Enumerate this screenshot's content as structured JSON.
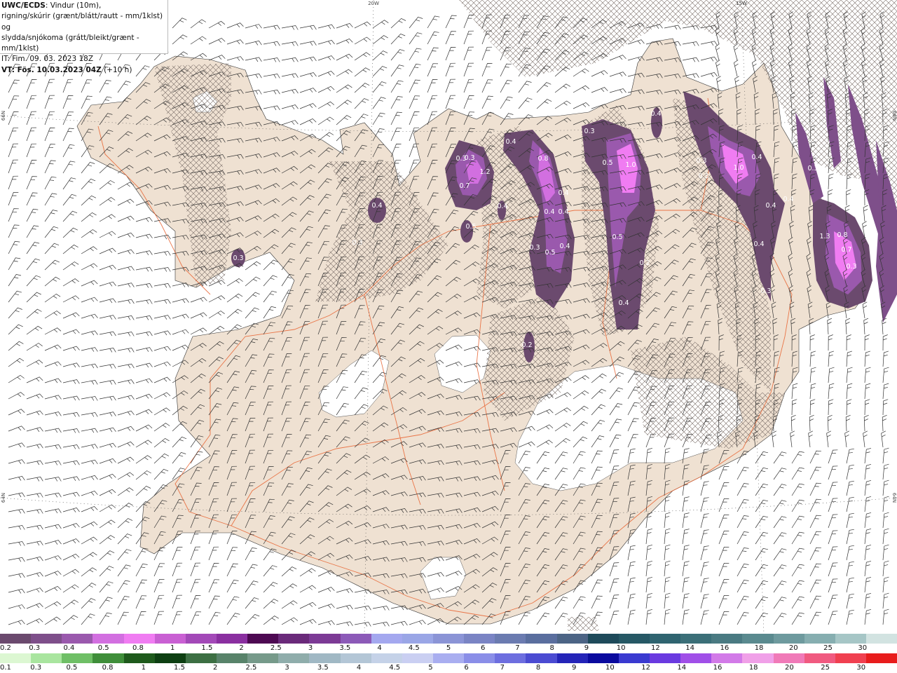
{
  "header": {
    "model": "UWC/ECDS",
    "description_line1": ": Vindur (10m),",
    "description_line2": "rigning/skúrir (grænt/blátt/rautt - mm/1klst) og",
    "description_line3": "slydda/snjókoma (grátt/bleikt/grænt - mm/1klst)",
    "issue_time": "IT: Fim. 09. 03. 2023 18Z",
    "valid_time": "VT: Fös. 10.03.2023 04Z",
    "lead_time": " (+10 h)"
  },
  "grid_labels": {
    "lon_20w": "20W",
    "lon_15w": "15W",
    "lat_left_upper": "66N",
    "lat_right_upper": "66N",
    "lat_left_lower": "64N",
    "lat_right_lower": "64N"
  },
  "precip_values": [
    "0.3",
    "0.3",
    "1.2",
    "0.7",
    "0.5",
    "0.4",
    "0.3",
    "0.3",
    "0.4",
    "0.8",
    "0.4",
    "0.4",
    "0.4",
    "0.4",
    "0.3",
    "0.5",
    "0.4",
    "0.3",
    "0.5",
    "1.0",
    "0.5",
    "0.2",
    "0.4",
    "0.4",
    "0.3",
    "0.3",
    "1.0",
    "0.4",
    "0.4",
    "0.4",
    "0.4",
    "0.3",
    "0.3",
    "1.3",
    "0.8",
    "0.7",
    "0.3",
    "0.2"
  ],
  "colors": {
    "land": "#efe1d2",
    "sea": "#ffffff",
    "roads": "#e8622f",
    "snow_scale": [
      "#6b4a6e",
      "#7e4f8a",
      "#9a59ad",
      "#d26fe0",
      "#f07cf2",
      "#c960d3",
      "#a349b8",
      "#8a2fa0",
      "#4d0952",
      "#6a2a7a",
      "#7c3a95",
      "#8c5ab8",
      "#a4a8ef",
      "#9aa6e6",
      "#8b94d6",
      "#7a84c4",
      "#6b7bb0",
      "#5a6e9e",
      "#4c6485",
      "#1e4a5a",
      "#265865",
      "#2f6470",
      "#3b6f78",
      "#4a7a82",
      "#5a8a8f",
      "#6e9a9e",
      "#86aeb0",
      "#a6c6c6",
      "#d2e3e1"
    ],
    "rain_scale": [
      "#dcf7d2",
      "#a9e59f",
      "#6fbf66",
      "#3f8e3a",
      "#1e5a1c",
      "#0d3f12",
      "#3c6f43",
      "#58836a",
      "#769a8a",
      "#8fadab",
      "#a0b8c4",
      "#b3c6d6",
      "#c5d2e8",
      "#cacff2",
      "#a9aef0",
      "#8a8ee8",
      "#6d6edf",
      "#4b4bd2",
      "#2424b8",
      "#0a0a9e",
      "#3a3ad0",
      "#6a3ae0",
      "#a04fe8",
      "#d27ae8",
      "#f0a0e8",
      "#f07ab8",
      "#f05a80",
      "#f04050",
      "#e81c1c"
    ]
  },
  "snow_scale": {
    "labels": [
      "0.2",
      "0.3",
      "0.4",
      "0.5",
      "0.8",
      "1",
      "1.5",
      "2",
      "2.5",
      "3",
      "3.5",
      "4",
      "4.5",
      "5",
      "6",
      "7",
      "8",
      "9",
      "10",
      "12",
      "14",
      "16",
      "18",
      "20",
      "25",
      "30"
    ]
  },
  "rain_scale": {
    "labels": [
      "0.1",
      "0.3",
      "0.5",
      "0.8",
      "1",
      "1.5",
      "2",
      "2.5",
      "3",
      "3.5",
      "4",
      "4.5",
      "5",
      "6",
      "7",
      "8",
      "9",
      "10",
      "12",
      "14",
      "16",
      "18",
      "20",
      "25",
      "30"
    ]
  }
}
